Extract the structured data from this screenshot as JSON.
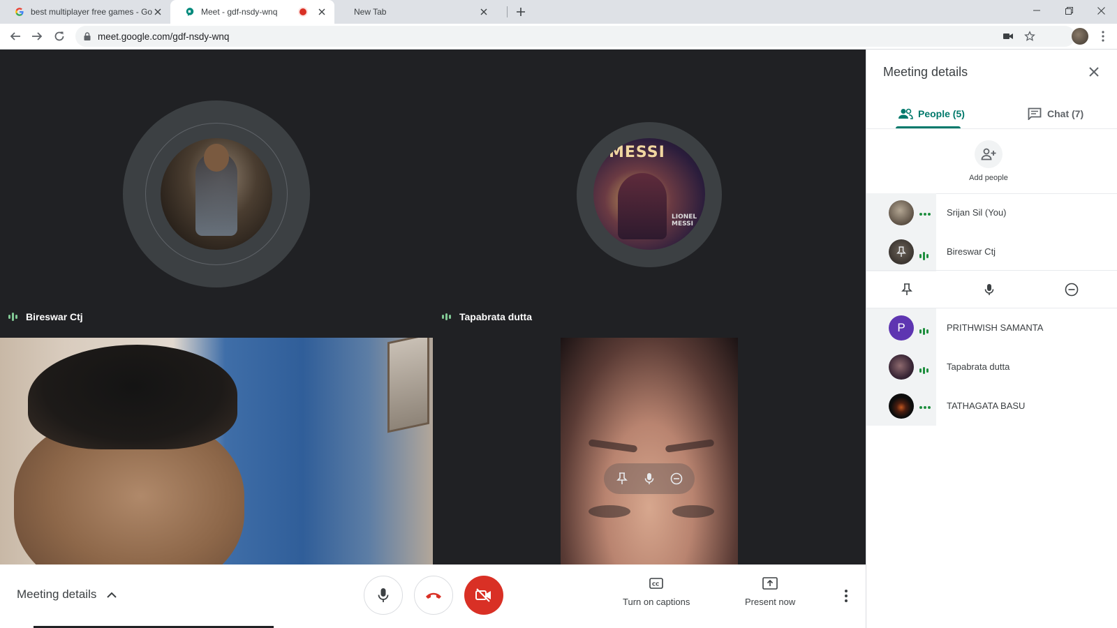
{
  "browser": {
    "tabs": [
      {
        "title": "best multiplayer free games - Go",
        "active": false
      },
      {
        "title": "Meet - gdf-nsdy-wnq",
        "active": true,
        "recording": true
      },
      {
        "title": "New Tab",
        "active": false
      }
    ],
    "url": "meet.google.com/gdf-nsdy-wnq"
  },
  "stage": {
    "tiles": [
      {
        "name": "Bireswar Ctj",
        "kind": "avatar"
      },
      {
        "name": "Tapabrata dutta",
        "kind": "avatar"
      }
    ],
    "avatar_b_text": {
      "line1": "MESSI",
      "line2": "LIONEL MESSI"
    }
  },
  "callbar": {
    "meeting_details_label": "Meeting details",
    "captions_label": "Turn on captions",
    "present_label": "Present now"
  },
  "panel": {
    "title": "Meeting details",
    "tabs": {
      "people": "People (5)",
      "chat": "Chat (7)"
    },
    "add_people_label": "Add people",
    "participants": [
      {
        "name": "Srijan Sil (You)",
        "status": "dots"
      },
      {
        "name": "Bireswar Ctj",
        "status": "bars"
      },
      {
        "name": "PRITHWISH SAMANTA",
        "status": "bars",
        "initial": "P"
      },
      {
        "name": "Tapabrata dutta",
        "status": "bars"
      },
      {
        "name": "TATHAGATA BASU",
        "status": "dots"
      }
    ]
  },
  "colors": {
    "accent": "#00796b",
    "hangup": "#d93025",
    "stage_bg": "#202124",
    "speaking": "#81c995",
    "avatar_purple": "#5e35b1"
  }
}
